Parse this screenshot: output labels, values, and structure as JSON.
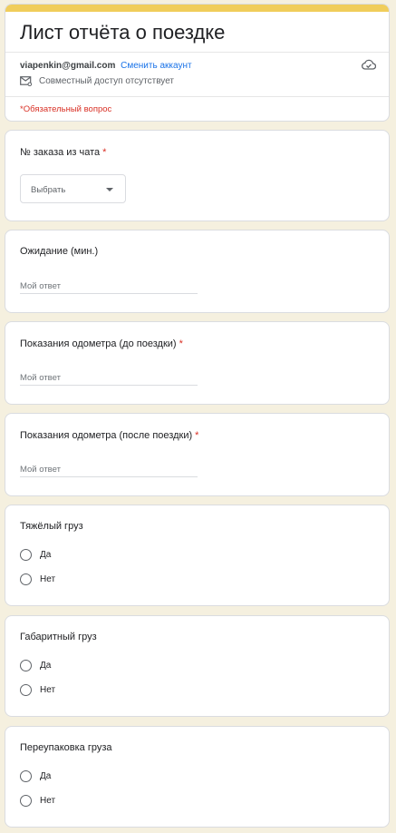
{
  "header": {
    "title": "Лист отчёта о поездке",
    "email": "viapenkin@gmail.com",
    "switch_account": "Сменить аккаунт",
    "sharing_status": "Совместный доступ отсутствует",
    "required_note": "*Обязательный вопрос"
  },
  "questions": {
    "order_number": {
      "title": "№ заказа из чата",
      "required_mark": "*",
      "dropdown_value": "Выбрать"
    },
    "waiting": {
      "title": "Ожидание (мин.)",
      "placeholder": "Мой ответ"
    },
    "odometer_before": {
      "title": "Показания одометра (до поездки)",
      "required_mark": "*",
      "placeholder": "Мой ответ"
    },
    "odometer_after": {
      "title": "Показания одометра (после поездки)",
      "required_mark": "*",
      "placeholder": "Мой ответ"
    },
    "heavy_cargo": {
      "title": "Тяжёлый груз",
      "options": [
        "Да",
        "Нет"
      ]
    },
    "oversized_cargo": {
      "title": "Габаритный груз",
      "options": [
        "Да",
        "Нет"
      ]
    },
    "repacking": {
      "title": "Переупаковка груза",
      "options": [
        "Да",
        "Нет"
      ]
    }
  },
  "colors": {
    "background": "#f5f0df",
    "accent_bar": "#f0cd5b",
    "required": "#d93025",
    "link": "#1a73e8"
  },
  "icons": {
    "sharing": "mail-share-icon",
    "cloud": "cloud-check-icon",
    "dropdown": "caret-down-icon"
  }
}
